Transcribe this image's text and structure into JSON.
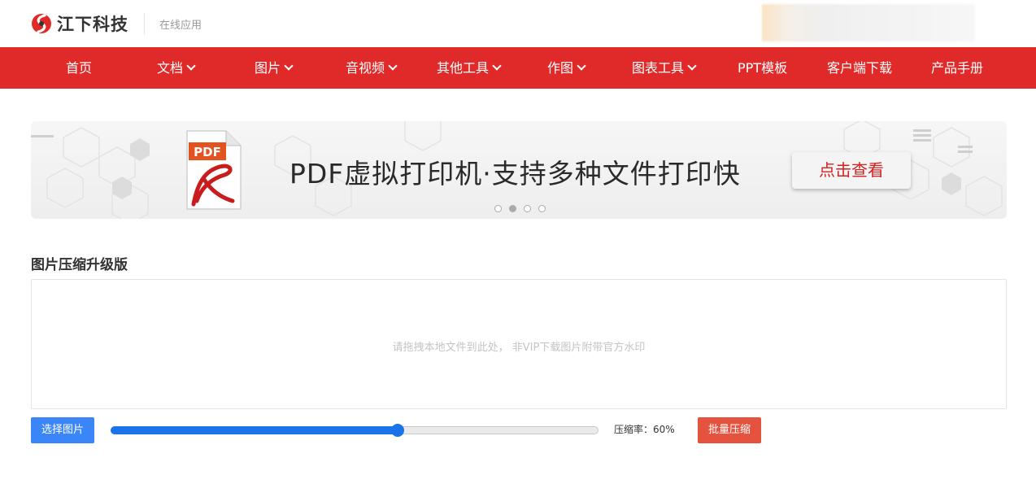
{
  "header": {
    "brand": "江下科技",
    "app_link": "在线应用"
  },
  "nav": {
    "items": [
      {
        "label": "首页",
        "dropdown": false
      },
      {
        "label": "文档",
        "dropdown": true
      },
      {
        "label": "图片",
        "dropdown": true
      },
      {
        "label": "音视频",
        "dropdown": true
      },
      {
        "label": "其他工具",
        "dropdown": true
      },
      {
        "label": "作图",
        "dropdown": true
      },
      {
        "label": "图表工具",
        "dropdown": true
      },
      {
        "label": "PPT模板",
        "dropdown": false
      },
      {
        "label": "客户端下载",
        "dropdown": false
      },
      {
        "label": "产品手册",
        "dropdown": false
      }
    ]
  },
  "banner": {
    "icon_label": "PDF",
    "title": "PDF虚拟打印机·支持多种文件打印快",
    "button": "点击查看",
    "slides": 4,
    "active_slide": 2
  },
  "compress": {
    "title": "图片压缩升级版",
    "drop_hint": "请拖拽本地文件到此处， 非VIP下载图片附带官方水印",
    "select_button": "选择图片",
    "ratio_label": "压缩率：60%",
    "ratio_value": 0.6,
    "batch_button": "批量压缩"
  },
  "colors": {
    "nav_bg": "#e02a2a",
    "select_button": "#3a86f8",
    "batch_button": "#e5533f",
    "slider_fill": "#1a73e8"
  }
}
